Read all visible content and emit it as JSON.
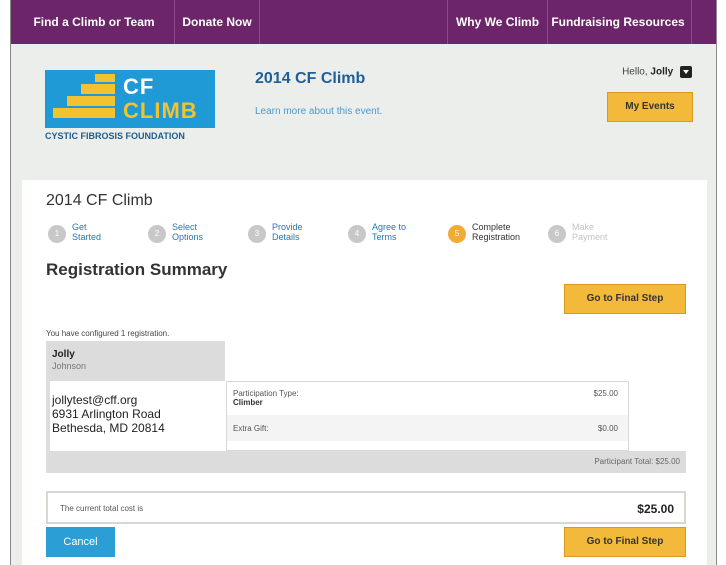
{
  "nav": {
    "find": "Find a Climb or Team",
    "donate": "Donate Now",
    "why": "Why We Climb",
    "resources": "Fundraising Resources"
  },
  "logo": {
    "cf": "CF",
    "climb": "CLIMB",
    "foundation": "CYSTIC FIBROSIS FOUNDATION"
  },
  "header": {
    "event_title": "2014 CF Climb",
    "event_link": "Learn more about this event.",
    "hello_prefix": "Hello,",
    "user": "Jolly",
    "my_events": "My Events"
  },
  "page": {
    "title": "2014 CF Climb",
    "section_title": "Registration Summary",
    "go_final": "Go to Final Step",
    "cancel": "Cancel"
  },
  "steps": [
    {
      "num": "1",
      "line1": "Get",
      "line2": "Started"
    },
    {
      "num": "2",
      "line1": "Select",
      "line2": "Options"
    },
    {
      "num": "3",
      "line1": "Provide",
      "line2": "Details"
    },
    {
      "num": "4",
      "line1": "Agree to",
      "line2": "Terms"
    },
    {
      "num": "5",
      "line1": "Complete",
      "line2": "Registration"
    },
    {
      "num": "6",
      "line1": "Make",
      "line2": "Payment"
    }
  ],
  "registration": {
    "configured": "You have configured 1 registration.",
    "first_name": "Jolly",
    "last_name": "Johnson",
    "email": "jollytest@cff.org",
    "address1": "6931 Arlington Road",
    "address2": "Bethesda, MD 20814",
    "participation_label": "Participation Type:",
    "participation_value": "Climber",
    "participation_price": "$25.00",
    "gift_label": "Extra Gift:",
    "gift_price": "$0.00",
    "participant_total": "Participant Total: $25.00"
  },
  "summary": {
    "cost_label": "The current total cost is",
    "cost_amount": "$25.00"
  },
  "colors": {
    "nav_bg": "#6b2568",
    "accent_yellow": "#f3b93b",
    "brand_blue": "#1f9ad6",
    "active_step": "#f2ac36"
  }
}
